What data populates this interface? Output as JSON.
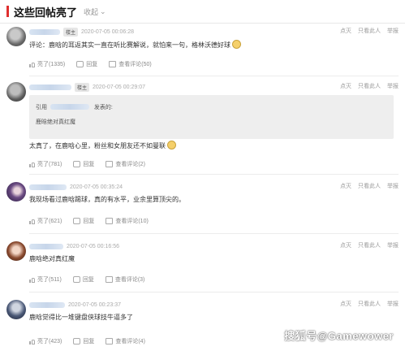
{
  "header": {
    "title": "这些回帖亮了",
    "collapse_label": "收起"
  },
  "posts": [
    {
      "author_badge": "楼主",
      "time": "2020-07-05 00:06:28",
      "content": "评论：鹿晗的耳返其实一直在听比赛解说，就怕来一句，格林沃德好球",
      "likes": "亮了(1335)",
      "reply_label": "回复",
      "view_label": "查看评论(50)",
      "right_actions": [
        "点灭",
        "只看此人",
        "举报"
      ]
    },
    {
      "author_badge": "楼主",
      "time": "2020-07-05 00:29:07",
      "quote_prefix": "引用",
      "quote_suffix": "发表的:",
      "quote_text": "鹿晗绝对真红魔",
      "content": "太真了，在鹿晗心里，粉丝和女朋友还不如曼联",
      "likes": "亮了(781)",
      "reply_label": "回复",
      "view_label": "查看评论(2)",
      "right_actions": [
        "点灭",
        "只看此人",
        "举报"
      ]
    },
    {
      "time": "2020-07-05 00:35:24",
      "content": "我现场看过鹿晗踢球，真的有水平，业余里算顶尖的。",
      "likes": "亮了(621)",
      "reply_label": "回复",
      "view_label": "查看评论(10)",
      "right_actions": [
        "点灭",
        "只看此人",
        "举报"
      ]
    },
    {
      "time": "2020-07-05 00:16:56",
      "content": "鹿晗绝对真红魔",
      "likes": "亮了(511)",
      "reply_label": "回复",
      "view_label": "查看评论(3)",
      "right_actions": [
        "点灭",
        "只看此人",
        "举报"
      ]
    },
    {
      "time": "2020-07-05 00:23:37",
      "content": "鹿晗觉得比一堆键盘侠球技牛逼多了",
      "likes": "亮了(423)",
      "reply_label": "回复",
      "view_label": "查看评论(4)",
      "right_actions": [
        "点灭",
        "只看此人",
        "举报"
      ]
    }
  ],
  "watermark": "搜狐号@Gamewower"
}
